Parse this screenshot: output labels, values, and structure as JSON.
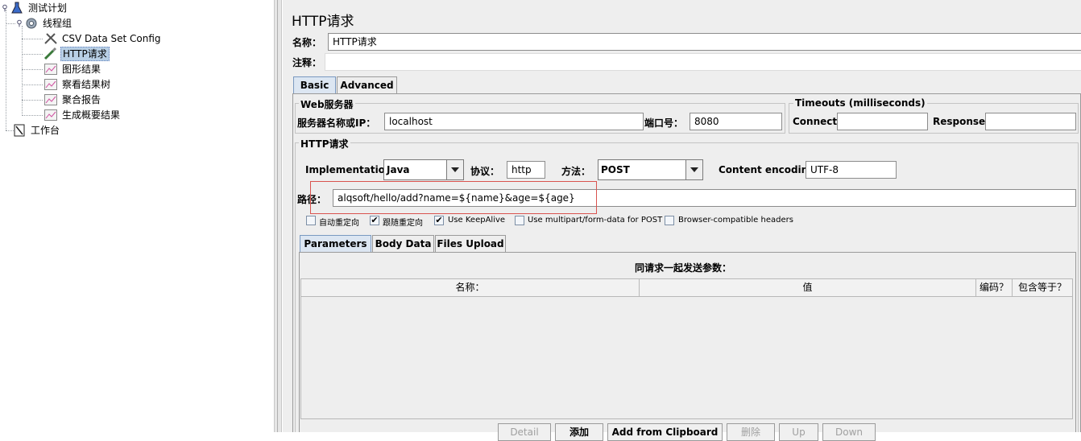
{
  "tree": {
    "root_label": "测试计划",
    "thread_group_label": "线程组",
    "items": [
      {
        "label": "CSV Data Set Config",
        "icon": "wrench-scissors-icon"
      },
      {
        "label": "HTTP请求",
        "icon": "pipette-icon",
        "selected": true
      },
      {
        "label": "图形结果",
        "icon": "graph-results-icon"
      },
      {
        "label": "察看结果树",
        "icon": "graph-results-icon"
      },
      {
        "label": "聚合报告",
        "icon": "graph-results-icon"
      },
      {
        "label": "生成概要结果",
        "icon": "graph-results-icon"
      }
    ],
    "workbench_label": "工作台"
  },
  "panel": {
    "title": "HTTP请求",
    "name_label": "名称：",
    "name_value": "HTTP请求",
    "comment_label": "注释：",
    "comment_value": ""
  },
  "tabs": {
    "basic": "Basic",
    "advanced": "Advanced"
  },
  "web_server": {
    "group_title": "Web服务器",
    "server_label": "服务器名称或IP：",
    "server_value": "localhost",
    "port_label": "端口号：",
    "port_value": "8080"
  },
  "timeouts": {
    "group_title": "Timeouts (milliseconds)",
    "connect_label": "Connect:",
    "connect_value": "",
    "response_label": "Response:",
    "response_value": ""
  },
  "http_request": {
    "group_title": "HTTP请求",
    "implementation_label": "Implementation:",
    "implementation_value": "Java",
    "protocol_label": "协议：",
    "protocol_value": "http",
    "method_label": "方法：",
    "method_value": "POST",
    "encoding_label": "Content encoding:",
    "encoding_value": "UTF-8",
    "path_label": "路径：",
    "path_value": "alqsoft/hello/add?name=${name}&age=${age}"
  },
  "options": [
    {
      "label": "自动重定向",
      "checked": false
    },
    {
      "label": "跟随重定向",
      "checked": true
    },
    {
      "label": "Use KeepAlive",
      "checked": true
    },
    {
      "label": "Use multipart/form-data for POST",
      "checked": false
    },
    {
      "label": "Browser-compatible headers",
      "checked": false
    }
  ],
  "sub_tabs": {
    "parameters": "Parameters",
    "body_data": "Body Data",
    "files_upload": "Files Upload"
  },
  "params_table": {
    "caption": "同请求一起发送参数：",
    "columns": [
      "名称：",
      "值",
      "编码？",
      "包含等于？"
    ]
  },
  "bottom_buttons": {
    "detail": "Detail",
    "add": "添加",
    "add_from_clipboard": "Add from Clipboard",
    "delete": "删除",
    "up": "Up",
    "down": "Down"
  },
  "colors": {
    "selection_bg": "#b8cfe5",
    "active_tab": "#dce6f2",
    "highlight_box": "#d9534f"
  }
}
